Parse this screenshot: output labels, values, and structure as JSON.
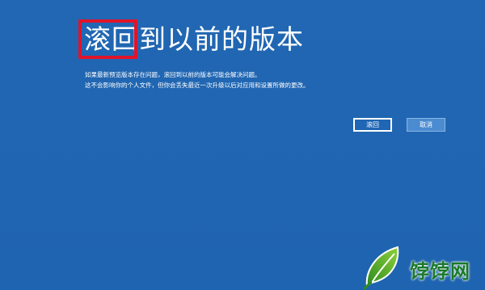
{
  "dialog": {
    "title": "滚回到以前的版本",
    "description_line1": "如果最新预览版本存在问题，滚回到以前的版本可能会解决问题。",
    "description_line2": "这不会影响你的个人文件，但你会丢失最近一次升级以后对应用和设置所做的更改。",
    "rollback_label": "滚回",
    "cancel_label": "取消"
  },
  "annotation": {
    "highlight_color": "#e0142b"
  },
  "watermark": {
    "text": "饽饽网",
    "icon": "green-leaf-logo-icon"
  },
  "colors": {
    "background": "#1f66b4",
    "text": "#ffffff",
    "cancel_button": "#4b8bd0",
    "watermark_text": "#1a7a2a"
  }
}
